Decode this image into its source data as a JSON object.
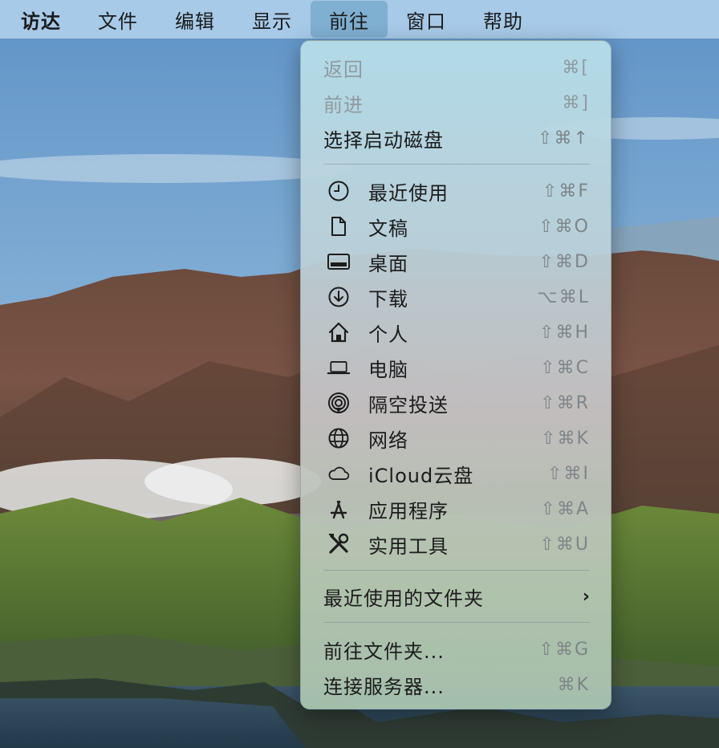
{
  "menubar": {
    "items": [
      {
        "label": "访达"
      },
      {
        "label": "文件"
      },
      {
        "label": "编辑"
      },
      {
        "label": "显示"
      },
      {
        "label": "前往"
      },
      {
        "label": "窗口"
      },
      {
        "label": "帮助"
      }
    ],
    "active_index": 4
  },
  "menu": {
    "top": [
      {
        "label": "返回",
        "shortcut": "⌘[",
        "enabled": false
      },
      {
        "label": "前进",
        "shortcut": "⌘]",
        "enabled": false
      },
      {
        "label": "选择启动磁盘",
        "shortcut": "⇧⌘↑",
        "enabled": true
      }
    ],
    "places": [
      {
        "label": "最近使用",
        "shortcut": "⇧⌘F",
        "icon": "clock-icon"
      },
      {
        "label": "文稿",
        "shortcut": "⇧⌘O",
        "icon": "document-icon"
      },
      {
        "label": "桌面",
        "shortcut": "⇧⌘D",
        "icon": "desktop-icon"
      },
      {
        "label": "下载",
        "shortcut": "⌥⌘L",
        "icon": "download-icon"
      },
      {
        "label": "个人",
        "shortcut": "⇧⌘H",
        "icon": "home-icon"
      },
      {
        "label": "电脑",
        "shortcut": "⇧⌘C",
        "icon": "laptop-icon"
      },
      {
        "label": "隔空投送",
        "shortcut": "⇧⌘R",
        "icon": "airdrop-icon"
      },
      {
        "label": "网络",
        "shortcut": "⇧⌘K",
        "icon": "network-globe-icon"
      },
      {
        "label": "iCloud云盘",
        "shortcut": "⇧⌘I",
        "icon": "cloud-icon"
      },
      {
        "label": "应用程序",
        "shortcut": "⇧⌘A",
        "icon": "applications-icon"
      },
      {
        "label": "实用工具",
        "shortcut": "⇧⌘U",
        "icon": "utilities-tools-icon"
      }
    ],
    "recent_folders": {
      "label": "最近使用的文件夹",
      "chevron": "›"
    },
    "bottom": [
      {
        "label": "前往文件夹...",
        "shortcut": "⇧⌘G"
      },
      {
        "label": "连接服务器...",
        "shortcut": "⌘K"
      }
    ]
  }
}
